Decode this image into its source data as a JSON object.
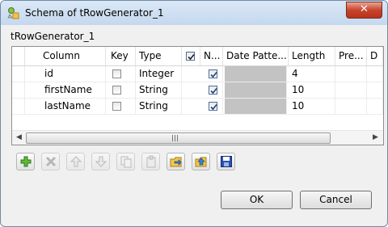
{
  "window": {
    "title": "Schema of tRowGenerator_1",
    "close_glyph": "✕"
  },
  "schema": {
    "name": "tRowGenerator_1"
  },
  "table": {
    "columns": [
      "Column",
      "Key",
      "Type",
      "",
      "N...",
      "Date Patte...",
      "Length",
      "Pre...",
      "D"
    ],
    "rows": [
      {
        "column": "id",
        "key": false,
        "type": "Integer",
        "nullable": true,
        "date_pattern": "",
        "length": "4"
      },
      {
        "column": "firstName",
        "key": false,
        "type": "String",
        "nullable": true,
        "date_pattern": "",
        "length": "10"
      },
      {
        "column": "lastName",
        "key": false,
        "type": "String",
        "nullable": true,
        "date_pattern": "",
        "length": "10"
      }
    ]
  },
  "scrollbar": {
    "left_arrow": "◀",
    "right_arrow": "▶"
  },
  "toolbar": {
    "icons": [
      "add-icon",
      "delete-icon",
      "move-up-icon",
      "move-down-icon",
      "copy-icon",
      "paste-icon",
      "import-schema-icon",
      "export-schema-icon",
      "save-icon"
    ]
  },
  "buttons": {
    "ok": "OK",
    "cancel": "Cancel"
  }
}
